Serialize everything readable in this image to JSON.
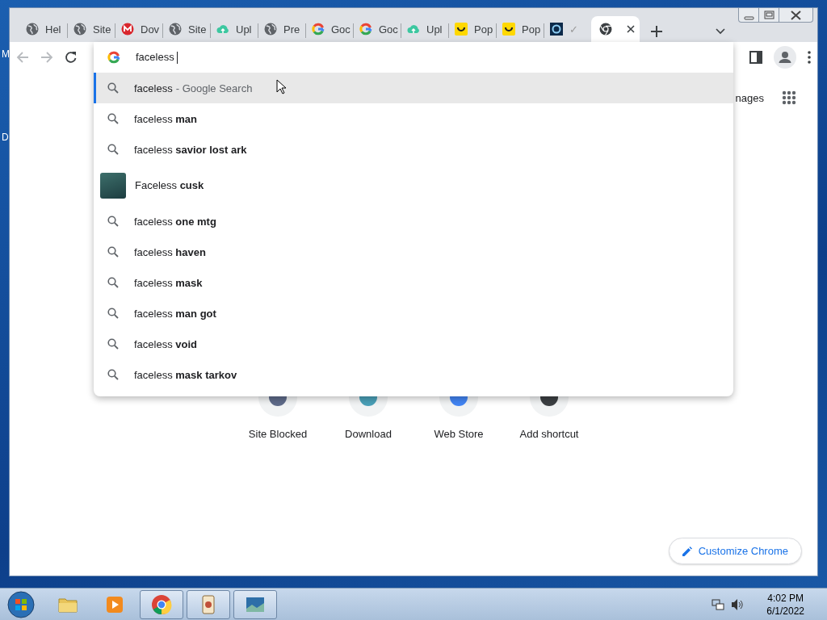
{
  "desktop": {
    "labels": [
      "M",
      "D"
    ]
  },
  "browser": {
    "tabs": [
      {
        "title": "Hel",
        "kind": "globe",
        "selected": false
      },
      {
        "title": "Site",
        "kind": "globe",
        "selected": false
      },
      {
        "title": "Dov",
        "kind": "mega",
        "selected": false
      },
      {
        "title": "Site",
        "kind": "globe",
        "selected": false
      },
      {
        "title": "Upl",
        "kind": "upload",
        "selected": false
      },
      {
        "title": "Pre",
        "kind": "globe",
        "selected": false
      },
      {
        "title": "Goc",
        "kind": "google",
        "selected": false
      },
      {
        "title": "Goc",
        "kind": "google",
        "selected": false
      },
      {
        "title": "Upl",
        "kind": "upload",
        "selected": false
      },
      {
        "title": "Pop",
        "kind": "smiley",
        "selected": false
      },
      {
        "title": "Pop",
        "kind": "smiley",
        "selected": false
      },
      {
        "title": "✓",
        "kind": "dark",
        "selected": false
      },
      {
        "kind": "chrome",
        "selected": true
      }
    ],
    "address": {
      "value": "faceless"
    },
    "suggestions": [
      {
        "kind": "search",
        "text": "faceless",
        "note": "- Google Search",
        "selected": true
      },
      {
        "kind": "search",
        "text": "faceless **man**",
        "selected": false
      },
      {
        "kind": "search",
        "text": "faceless **savior lost ark**",
        "selected": false
      },
      {
        "kind": "entity",
        "text": "Faceless **cusk**",
        "selected": false
      },
      {
        "kind": "search",
        "text": "faceless **one mtg**",
        "selected": false
      },
      {
        "kind": "search",
        "text": "faceless **haven**",
        "selected": false
      },
      {
        "kind": "search",
        "text": "faceless **mask**",
        "selected": false
      },
      {
        "kind": "search",
        "text": "faceless **man got**",
        "selected": false
      },
      {
        "kind": "search",
        "text": "faceless **void**",
        "selected": false
      },
      {
        "kind": "search",
        "text": "faceless **mask tarkov**",
        "selected": false
      }
    ],
    "page": {
      "header_link": "nages",
      "shortcuts": [
        "Site Blocked",
        "Download",
        "Web Store",
        "Add shortcut"
      ],
      "customize_button": "Customize Chrome"
    }
  },
  "taskbar": {
    "apps": [
      {
        "kind": "explorer",
        "running": false
      },
      {
        "kind": "media",
        "running": false
      },
      {
        "kind": "chrome",
        "running": true
      },
      {
        "kind": "cards",
        "running": true
      },
      {
        "kind": "photo",
        "running": true
      }
    ],
    "clock": {
      "time": "4:02 PM",
      "date": "6/1/2022"
    }
  }
}
